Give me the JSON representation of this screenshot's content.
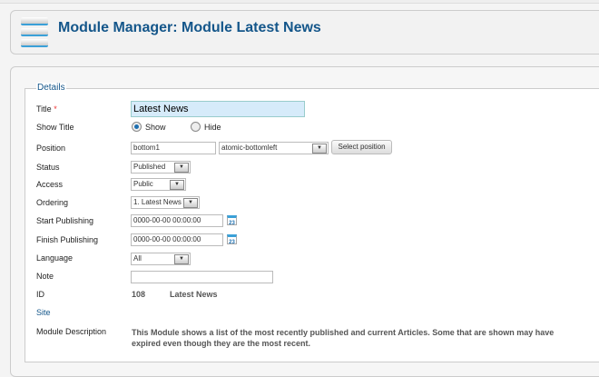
{
  "header": {
    "title": "Module Manager: Module Latest News"
  },
  "details": {
    "legend": "Details",
    "labels": {
      "title": "Title",
      "required": "*",
      "show_title": "Show Title",
      "position": "Position",
      "status": "Status",
      "access": "Access",
      "ordering": "Ordering",
      "start": "Start Publishing",
      "finish": "Finish Publishing",
      "language": "Language",
      "note": "Note",
      "id": "ID",
      "site": "Site",
      "description": "Module Description"
    },
    "title_value": "Latest News",
    "show_options": [
      "Show",
      "Hide"
    ],
    "show_selected": "Show",
    "position_value": "bottom1",
    "position_select": "atomic-bottomleft",
    "select_position": "Select position",
    "status": "Published",
    "access": "Public",
    "ordering": "1. Latest News",
    "start": "0000-00-00 00:00:00",
    "finish": "0000-00-00 00:00:00",
    "calendar_day": "23",
    "language": "All",
    "note": "",
    "id": "108",
    "id_name": "Latest News",
    "description": "This Module shows a list of the most recently published and current Articles. Some that are shown may have expired even though they are the most recent."
  }
}
